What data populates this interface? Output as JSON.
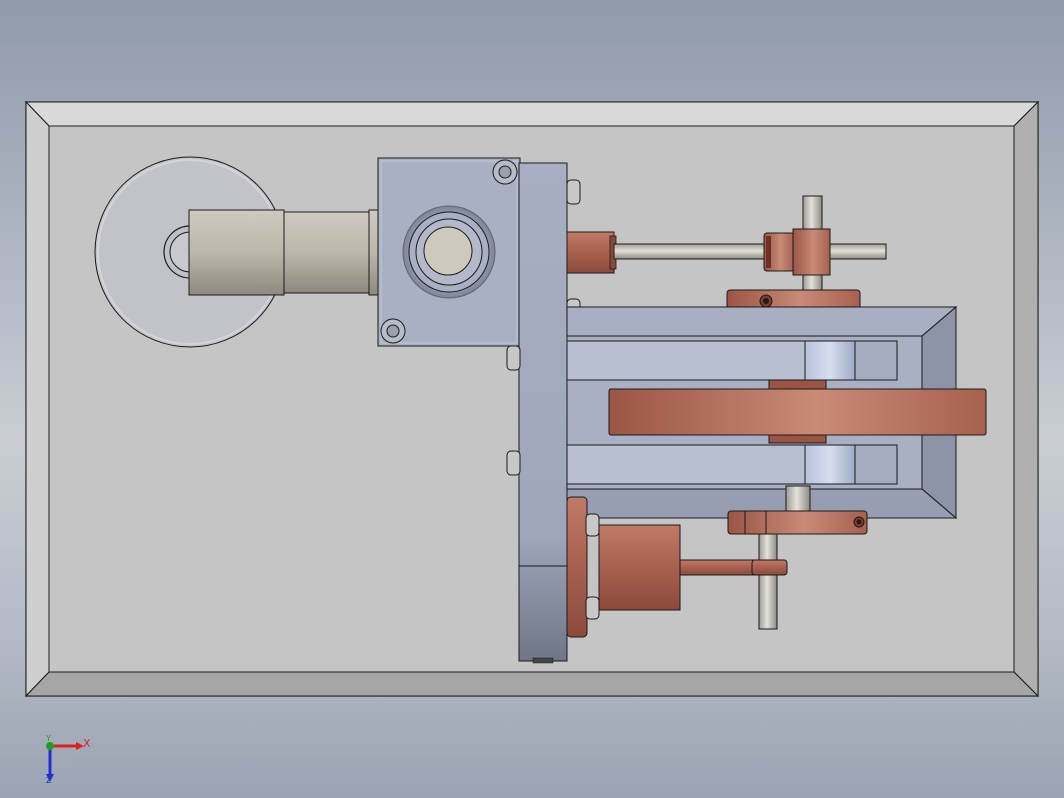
{
  "viewport": {
    "background_top": "#8f9aab",
    "background_mid": "#c9cdd3",
    "model": "stirling-engine-top-view"
  },
  "colors": {
    "plate": "#c4c4c4",
    "plate_bevel": "#d8d8d8",
    "steel": "#a9b0c3",
    "steel_dark": "#8e95a8",
    "copper": "#a85f4d",
    "copper_light": "#c98976",
    "rod": "#c5c0b8",
    "edge": "#1a1a1a"
  },
  "triad": {
    "x_label": "X",
    "y_label": "Y",
    "z_label": "Z",
    "x_color": "#e02020",
    "y_color": "#20a020",
    "z_color": "#2030d0",
    "icon": "coordinate-triad-icon"
  }
}
